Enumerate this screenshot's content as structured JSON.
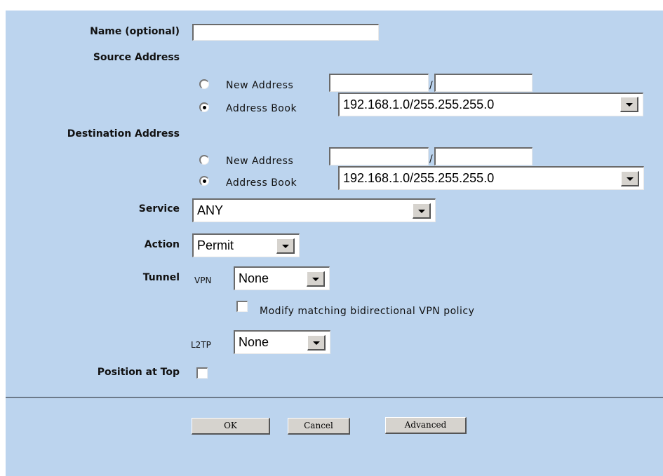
{
  "form": {
    "name_label": "Name (optional)",
    "name_value": "",
    "source": {
      "label": "Source Address",
      "new_address_label": "New Address",
      "new_address_ip": "",
      "separator": "/",
      "new_address_mask": "",
      "address_book_label": "Address Book",
      "address_book_value": "192.168.1.0/255.255.255.0",
      "selected": "Address Book"
    },
    "destination": {
      "label": "Destination Address",
      "new_address_label": "New Address",
      "new_address_ip": "",
      "separator": "/",
      "new_address_mask": "",
      "address_book_label": "Address Book",
      "address_book_value": "192.168.1.0/255.255.255.0",
      "selected": "Address Book"
    },
    "service_label": "Service",
    "service_value": "ANY",
    "action_label": "Action",
    "action_value": "Permit",
    "tunnel": {
      "label": "Tunnel",
      "vpn_label": "VPN",
      "vpn_value": "None",
      "modify_label": "Modify matching bidirectional VPN policy",
      "modify_checked": false,
      "l2tp_label": "L2TP",
      "l2tp_value": "None"
    },
    "position_label": "Position at Top",
    "position_checked": false
  },
  "buttons": {
    "ok": "OK",
    "cancel": "Cancel",
    "advanced": "Advanced"
  }
}
